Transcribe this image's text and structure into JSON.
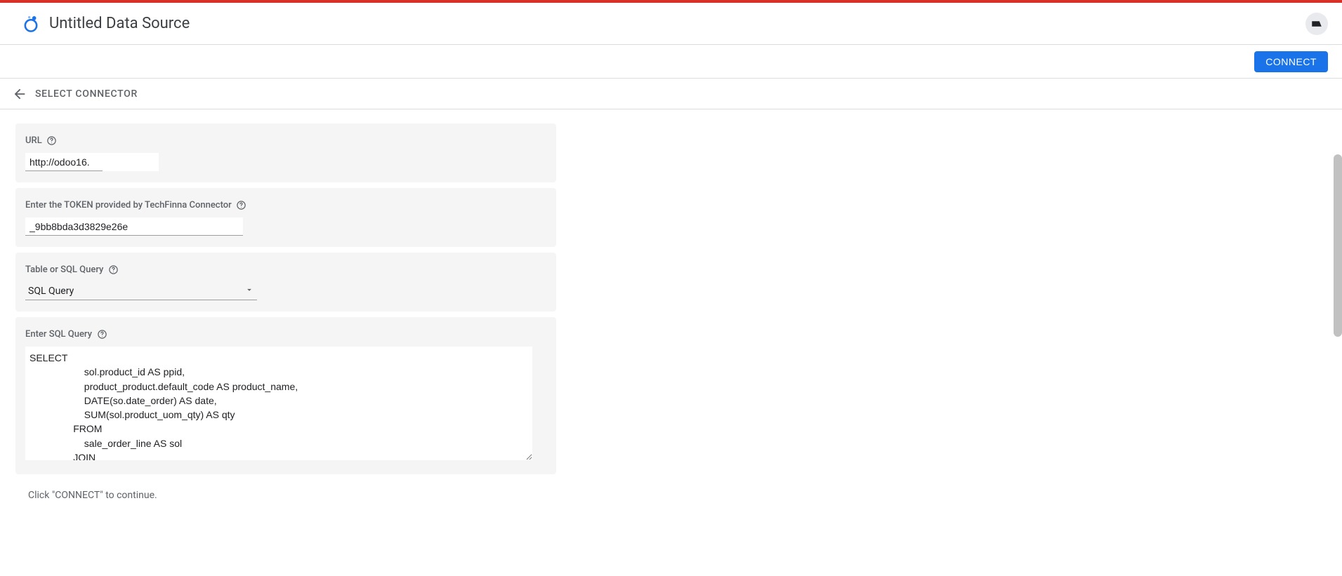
{
  "header": {
    "title": "Untitled Data Source"
  },
  "actionBar": {
    "connect_label": "CONNECT"
  },
  "breadcrumb": {
    "label": "SELECT CONNECTOR"
  },
  "form": {
    "url": {
      "label": "URL",
      "value": "http://odoo16."
    },
    "token": {
      "label": "Enter the TOKEN provided by TechFinna Connector",
      "value": "_9bb8bda3d3829e26e"
    },
    "queryType": {
      "label": "Table or SQL Query",
      "selected": "SQL Query"
    },
    "sql": {
      "label": "Enter SQL Query",
      "value": "SELECT\n                    sol.product_id AS ppid,\n                    product_product.default_code AS product_name,\n                    DATE(so.date_order) AS date,\n                    SUM(sol.product_uom_qty) AS qty\n                FROM\n                    sale_order_line AS sol\n                JOIN\n                    sale_order AS so ON sol.order_id = so.id\n                JOIN"
    }
  },
  "hint": "Click \"CONNECT\" to continue."
}
